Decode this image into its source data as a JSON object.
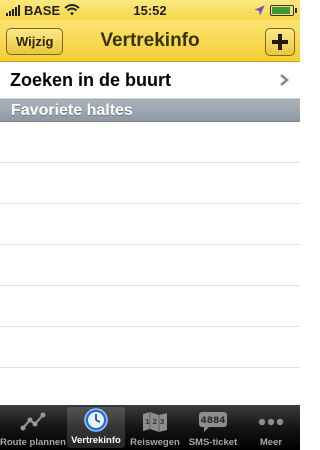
{
  "status": {
    "carrier": "BASE",
    "time": "15:52",
    "battery_level": 0.9
  },
  "nav": {
    "title": "Vertrekinfo",
    "edit_label": "Wijzig"
  },
  "list": {
    "nearby_label": "Zoeken in de buurt",
    "section_title": "Favoriete haltes"
  },
  "tabs": [
    {
      "label": "Route plannen",
      "icon": "route-icon"
    },
    {
      "label": "Vertrekinfo",
      "icon": "clock-icon"
    },
    {
      "label": "Reiswegen",
      "icon": "map-icon"
    },
    {
      "label": "SMS-ticket",
      "icon": "sms-ticket-icon",
      "badge": "4884"
    },
    {
      "label": "Meer",
      "icon": "more-icon"
    }
  ],
  "colors": {
    "navbar": "#f6d64a",
    "section": "#9aa4ae",
    "active_tab": "#1b6fd6"
  }
}
